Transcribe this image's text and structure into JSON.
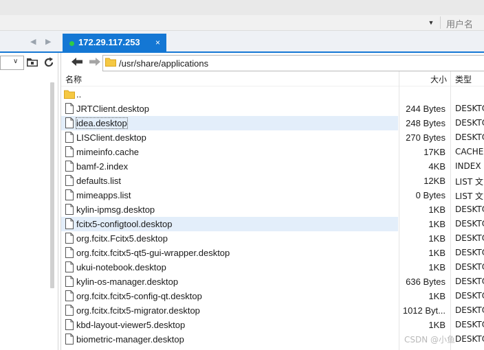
{
  "top_bar": {
    "user_label": "用户名"
  },
  "tab": {
    "label": "172.29.117.253",
    "close": "×",
    "status_color": "#2fcc45",
    "accent": "#1477d4"
  },
  "nav": {
    "prev_arrow": "◀",
    "next_arrow": "▶"
  },
  "left_pane": {
    "combo_value": ""
  },
  "path": {
    "value": "/usr/share/applications"
  },
  "columns": {
    "name": "名称",
    "size": "大小",
    "type": "类型"
  },
  "files": [
    {
      "name": "..",
      "size": "",
      "type": "",
      "kind": "folder"
    },
    {
      "name": "JRTClient.desktop",
      "size": "244 Bytes",
      "type": "DESKTOP",
      "kind": "file"
    },
    {
      "name": "idea.desktop",
      "size": "248 Bytes",
      "type": "DESKTOP",
      "kind": "file",
      "selected": true
    },
    {
      "name": "LISClient.desktop",
      "size": "270 Bytes",
      "type": "DESKTOP",
      "kind": "file"
    },
    {
      "name": "mimeinfo.cache",
      "size": "17KB",
      "type": "CACHE",
      "kind": "file"
    },
    {
      "name": "bamf-2.index",
      "size": "4KB",
      "type": "INDEX",
      "kind": "file"
    },
    {
      "name": "defaults.list",
      "size": "12KB",
      "type": "LIST 文",
      "kind": "file"
    },
    {
      "name": "mimeapps.list",
      "size": "0 Bytes",
      "type": "LIST 文",
      "kind": "file"
    },
    {
      "name": "kylin-ipmsg.desktop",
      "size": "1KB",
      "type": "DESKTOP",
      "kind": "file"
    },
    {
      "name": "fcitx5-configtool.desktop",
      "size": "1KB",
      "type": "DESKTOP",
      "kind": "file",
      "hover": true
    },
    {
      "name": "org.fcitx.Fcitx5.desktop",
      "size": "1KB",
      "type": "DESKTOP",
      "kind": "file"
    },
    {
      "name": "org.fcitx.fcitx5-qt5-gui-wrapper.desktop",
      "size": "1KB",
      "type": "DESKTOP",
      "kind": "file"
    },
    {
      "name": "ukui-notebook.desktop",
      "size": "1KB",
      "type": "DESKTOP",
      "kind": "file"
    },
    {
      "name": "kylin-os-manager.desktop",
      "size": "636 Bytes",
      "type": "DESKTOP",
      "kind": "file"
    },
    {
      "name": "org.fcitx.fcitx5-config-qt.desktop",
      "size": "1KB",
      "type": "DESKTOP",
      "kind": "file"
    },
    {
      "name": "org.fcitx.fcitx5-migrator.desktop",
      "size": "1012 Byt...",
      "type": "DESKTOP",
      "kind": "file"
    },
    {
      "name": "kbd-layout-viewer5.desktop",
      "size": "1KB",
      "type": "DESKTOP",
      "kind": "file"
    },
    {
      "name": "biometric-manager.desktop",
      "size": "",
      "type": "DESKTOP",
      "kind": "file"
    }
  ],
  "watermark": "CSDN @小鱼"
}
